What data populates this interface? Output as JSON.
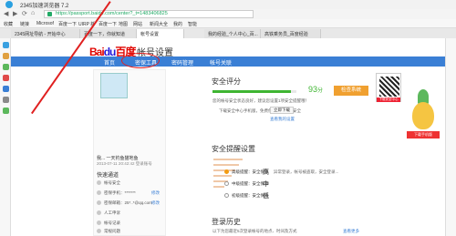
{
  "window": {
    "title": "2345加速浏览器 7.2"
  },
  "nav": {
    "back": "◀",
    "forward": "▶",
    "refresh": "⟳",
    "home": "⌂",
    "url": "https://passport.baidu.com/center?_t=1483406825"
  },
  "bookmarks": [
    "收藏",
    "链接",
    "Microsof",
    "百度一下",
    "UIRP 新",
    "百度一下",
    "地图",
    "网站",
    "新闻大全",
    "我的",
    "智能"
  ],
  "tabs": [
    "2345网址导航 - 开始中心",
    "百度一下，你就知道",
    "帐号设置",
    "我的经验_个人中心_百...",
    "高铁乘务员_百度经验"
  ],
  "sidebar_icons": [
    "#3aa0e0",
    "#e0a040",
    "#5cb85c",
    "#e04a4a",
    "#3a7fd5",
    "#8a8a8a",
    "#5cb85c"
  ],
  "header": {
    "brand_red": "Bai",
    "brand_blue": "du",
    "brand_suffix": "百度",
    "page_title": "帐号设置"
  },
  "main_nav": [
    "首页",
    "密保工具",
    "密码管理",
    "帐号关联"
  ],
  "profile": {
    "username": "我... 一天钓鱼猫地鱼",
    "joined": "2013-07-11 20:42:42 登录账号"
  },
  "quick": {
    "title": "快速通道",
    "items": [
      {
        "label": "帐号安全",
        "link": ""
      },
      {
        "label": "密保手机：*******",
        "link": "修改"
      },
      {
        "label": "密保邮箱：25*..*@qq.com",
        "link": "修改"
      },
      {
        "label": "人工申诉",
        "link": ""
      },
      {
        "label": "帐号记录",
        "link": ""
      },
      {
        "label": "常规问题",
        "link": ""
      }
    ]
  },
  "security": {
    "title": "安全评分",
    "score": "93",
    "score_unit": "分",
    "score_pct": 93,
    "hint1": "您的帐号安全状态良好，建议您设置1项安全提醒哦！",
    "hint2": "下载安全中心手机版，免费保护您的帐号安全",
    "btn": "立即下载",
    "more": "查看我的设置",
    "check_btn": "检查系统",
    "qr_label": "下载安全中心"
  },
  "alerts": {
    "title": "安全提醒设置",
    "levels": [
      {
        "label": "高级提醒：安全保障",
        "big": "高",
        "desc": "异常登录，帐号被盗取，安全登录..."
      },
      {
        "label": "中级提醒：安全保障",
        "big": "中",
        "desc": ""
      },
      {
        "label": "初级提醒：安全保障",
        "big": "低",
        "desc": ""
      }
    ]
  },
  "history": {
    "title": "登录历史",
    "hint": "以下为您最近5次登录帐号的地点、时间及方式",
    "more": "查看更多"
  },
  "mascot": {
    "tag": "下载手机版"
  }
}
